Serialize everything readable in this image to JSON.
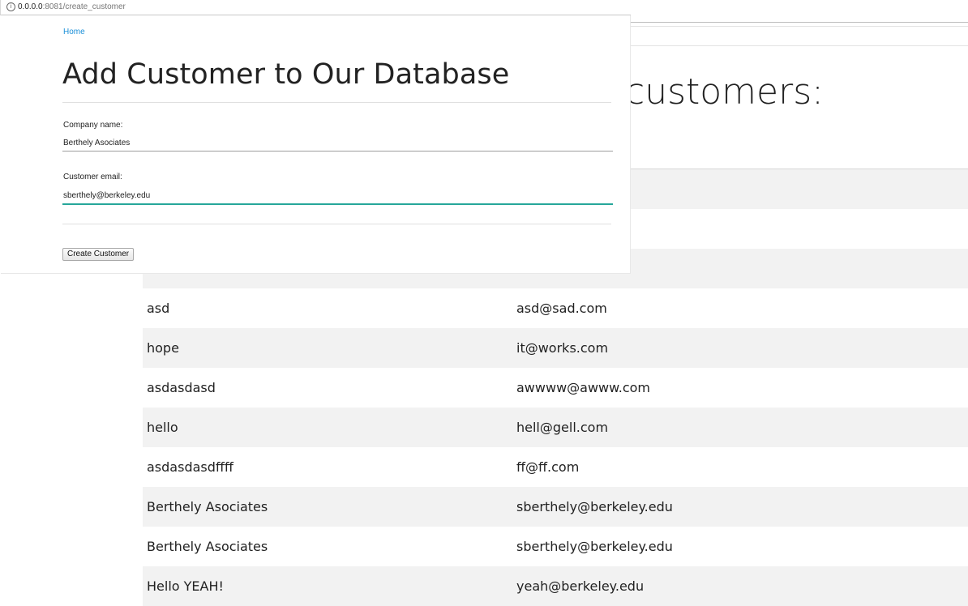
{
  "browser": {
    "url_host": "0.0.0.0",
    "url_path": ":8081/create_customer"
  },
  "nav": {
    "home_label": "Home"
  },
  "form": {
    "title": "Add Customer to Our Database",
    "company_label": "Company name:",
    "company_value": "Berthely Asociates",
    "email_label": "Customer email:",
    "email_value": "sberthely@berkeley.edu",
    "submit_label": "Create Customer",
    "focus_color": "#26a69a",
    "link_color": "#1a8fd8"
  },
  "background_page": {
    "heading_fragment": "customers:",
    "rows": [
      {
        "name": "asd",
        "email": "asd@sad.com"
      },
      {
        "name": "hope",
        "email": "it@works.com"
      },
      {
        "name": "asdasdasd",
        "email": "awwww@awww.com"
      },
      {
        "name": "hello",
        "email": "hell@gell.com"
      },
      {
        "name": "asdasdasdffff",
        "email": "ff@ff.com"
      },
      {
        "name": "Berthely Asociates",
        "email": "sberthely@berkeley.edu"
      },
      {
        "name": "Berthely Asociates",
        "email": "sberthely@berkeley.edu"
      },
      {
        "name": "Hello YEAH!",
        "email": "yeah@berkeley.edu"
      }
    ],
    "stripe_color": "#f2f2f2"
  }
}
